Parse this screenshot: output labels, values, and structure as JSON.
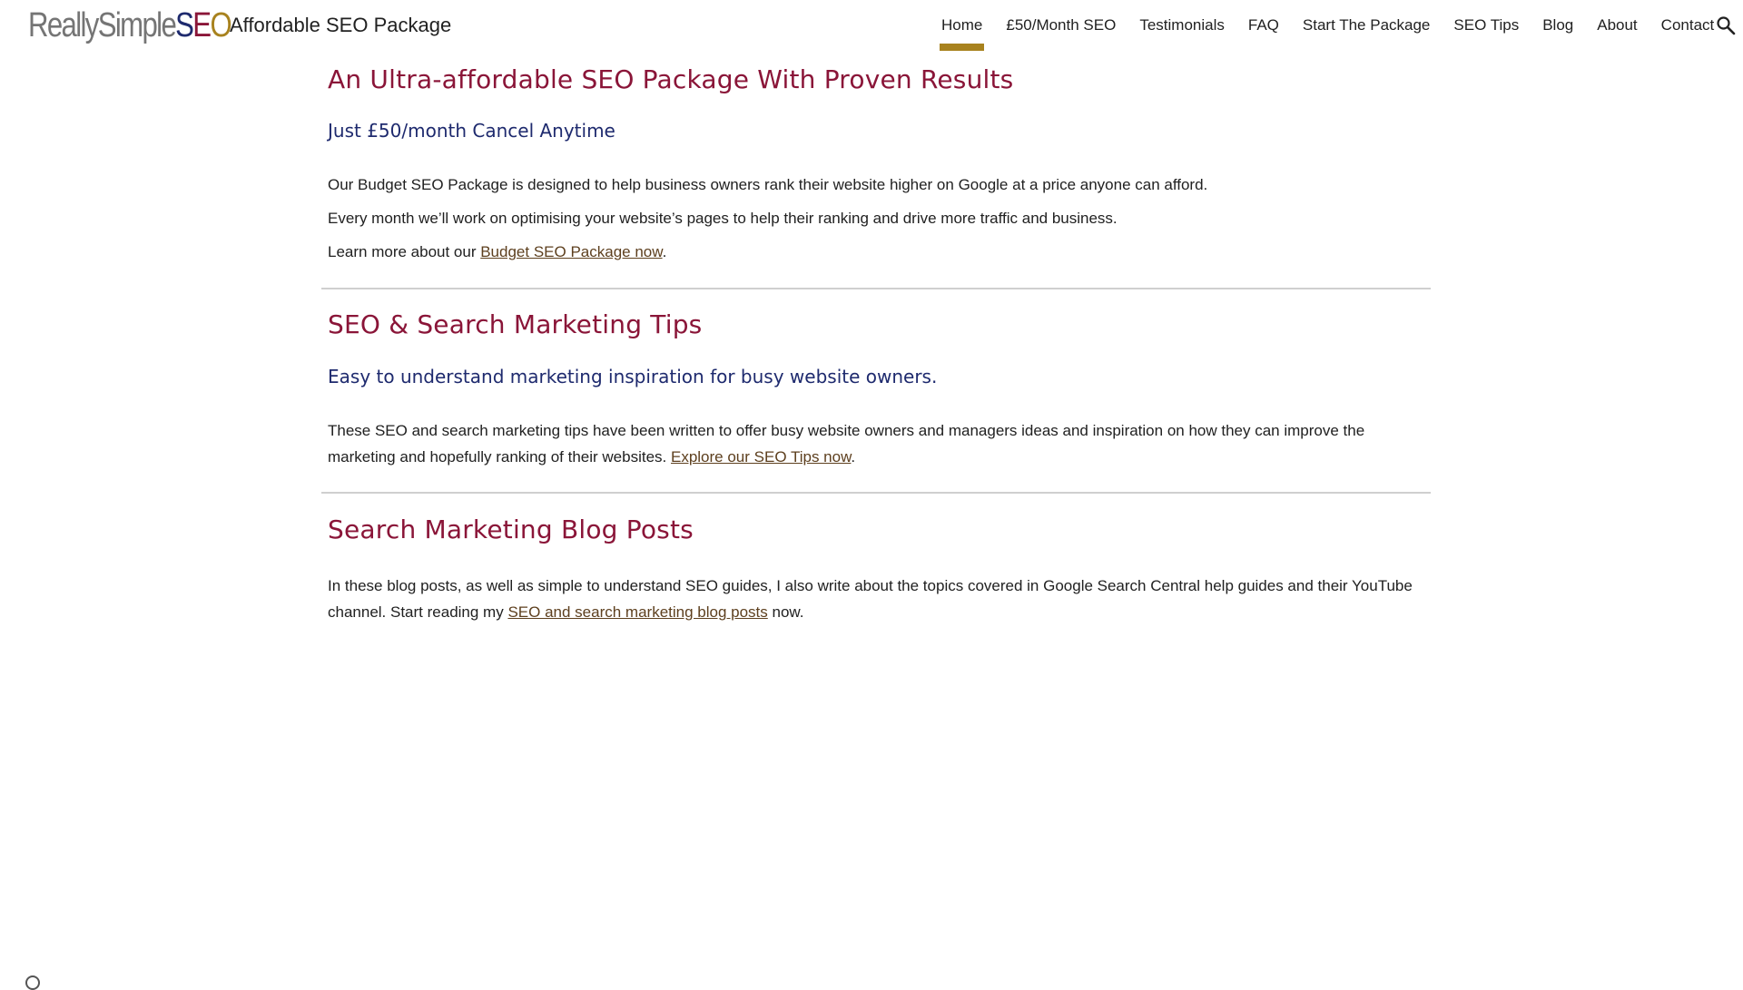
{
  "header": {
    "logo": {
      "part1": "ReallySimple",
      "s": "S",
      "e": "E",
      "o": "O"
    },
    "site_title": "Affordable SEO Package",
    "nav": [
      {
        "label": "Home"
      },
      {
        "label": "£50/Month SEO"
      },
      {
        "label": "Testimonials"
      },
      {
        "label": "FAQ"
      },
      {
        "label": "Start The Package"
      },
      {
        "label": "SEO Tips"
      },
      {
        "label": "Blog"
      },
      {
        "label": "About"
      },
      {
        "label": "Contact"
      }
    ],
    "active_nav": "Home",
    "search_icon": "search-icon"
  },
  "sections": {
    "package": {
      "title": "An Ultra-affordable SEO Package With Proven Results",
      "subtitle": "Just £50/month Cancel Anytime",
      "p1": "Our Budget SEO Package is designed to help business owners rank their website higher on Google at a price anyone can afford.",
      "p2": "Every month we’ll work on optimising your website’s pages to help their ranking and drive more traffic and business.",
      "p3_before": "Learn more about our ",
      "p3_link": "Budget SEO Package now",
      "p3_after": "."
    },
    "tips": {
      "title": "SEO & Search Marketing Tips",
      "subtitle": "Easy to understand marketing inspiration for busy website owners.",
      "p_before": "These SEO and search marketing tips have been written to offer busy website owners and managers ideas and inspiration on how they can improve the marketing and hopefully ranking of their websites. ",
      "p_link": "Explore our SEO Tips now",
      "p_after": "."
    },
    "blog": {
      "title": "Search Marketing Blog Posts",
      "p_before": "In these blog posts, as well as simple to understand SEO guides, I also write about the topics covered in Google Search Central help guides and their YouTube channel. Start reading my ",
      "p_link": "SEO and search marketing blog posts",
      "p_after": " now."
    }
  },
  "colors": {
    "heading": "#8a1538",
    "subheading": "#1e2a6e",
    "accent": "#a8821e",
    "link": "#5d3f1e",
    "logo_gray": "#757575"
  }
}
